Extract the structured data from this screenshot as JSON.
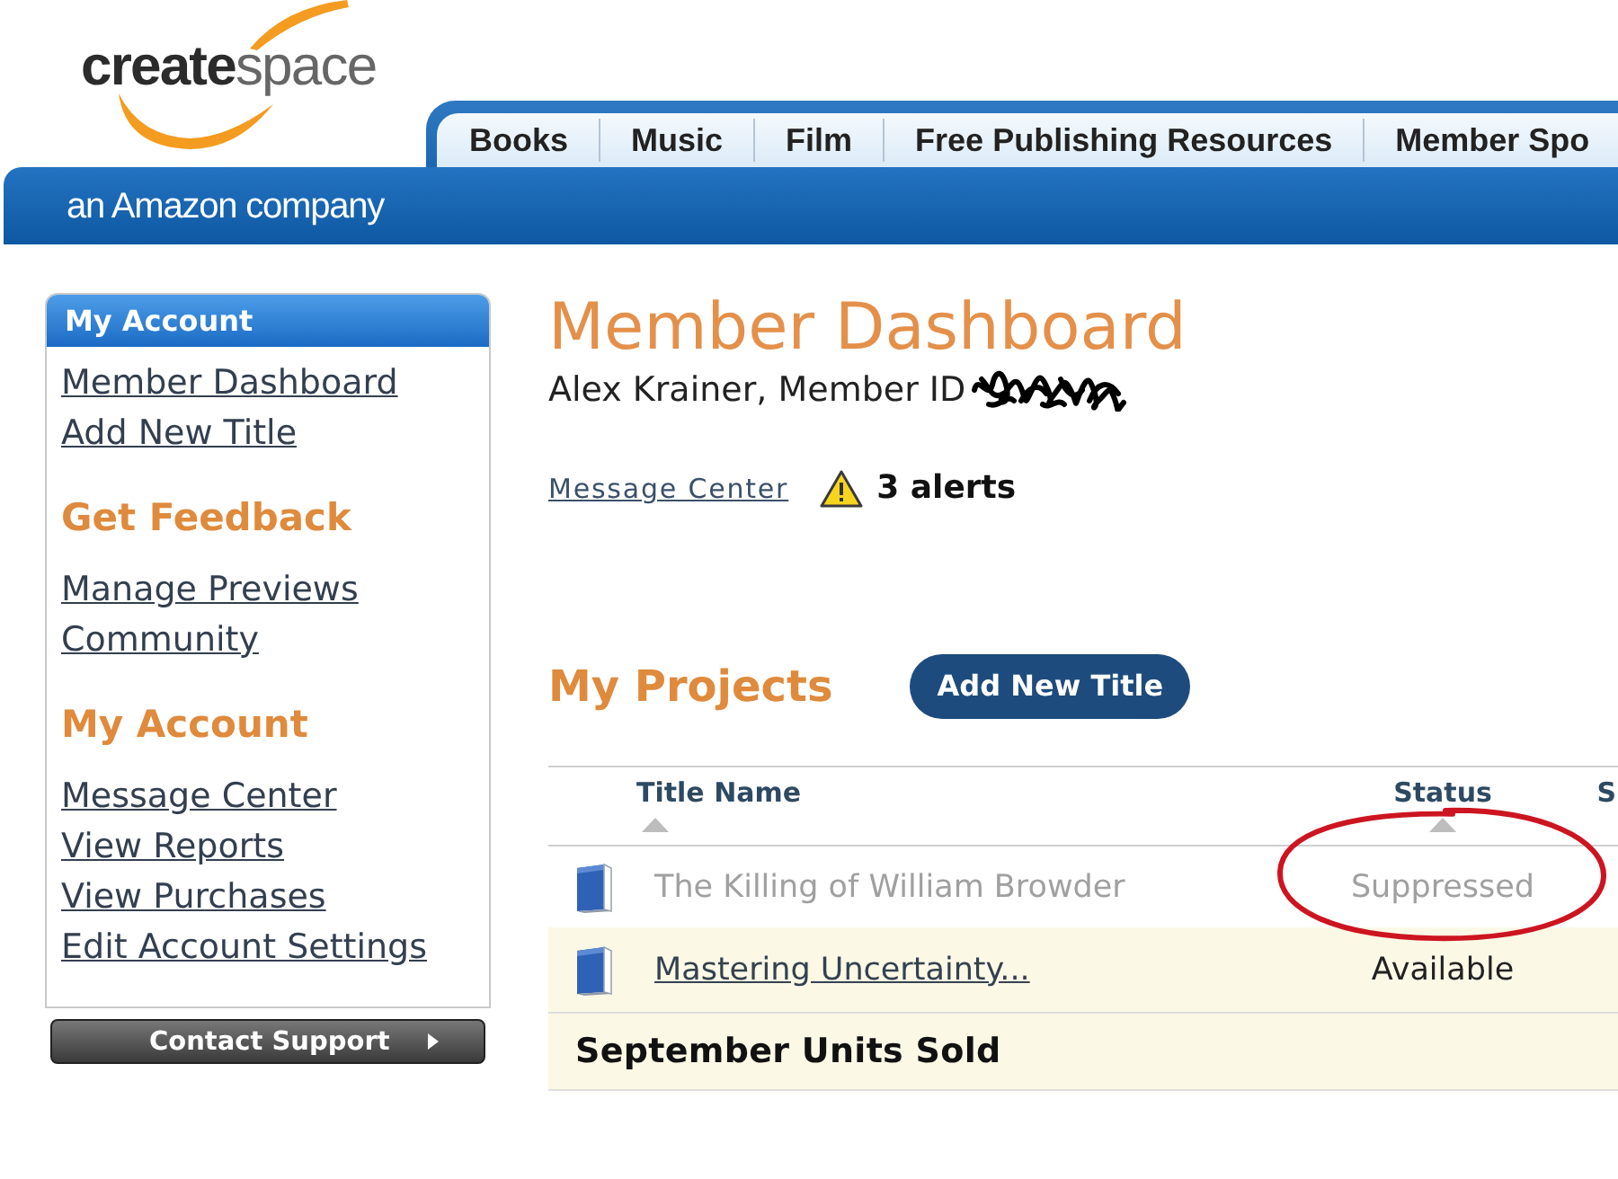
{
  "header": {
    "logo": "**create**space",
    "tagline": "an Amazon company",
    "tabs": [
      {
        "label": "Books",
        "selected": false
      },
      {
        "label": "Music",
        "selected": false
      },
      {
        "label": "Film",
        "selected": false
      },
      {
        "label": "Free Publishing Resources",
        "selected": false
      },
      {
        "label": "Member Spo",
        "selected": false
      }
    ]
  },
  "sidebar": {
    "title": "My Account",
    "sections": [
      {
        "links": [
          "Member Dashboard",
          "Add New Title"
        ]
      },
      {
        "heading": "Get Feedback",
        "links": [
          "Manage Previews",
          "Community"
        ]
      },
      {
        "heading": "My Account",
        "links": [
          "Message Center",
          "View Reports",
          "View Purchases",
          "Edit Account Settings"
        ]
      }
    ],
    "support_button": "Contact Support"
  },
  "main": {
    "title": "Member Dashboard",
    "member_line": "Alex Krainer, Member ID",
    "member_id_redacted": true,
    "message_link": "Message Center",
    "alerts": "3 alerts",
    "projects_heading": "My Projects",
    "add_button": "Add New Title",
    "table": {
      "columns": [
        {
          "label": "Title Name",
          "sort_arrow": true
        },
        {
          "label": "Status",
          "sort_arrow": true
        },
        {
          "label": "S",
          "sort_arrow": false
        }
      ],
      "rows": [
        {
          "title": "The Killing of William Browder",
          "status": "Suppressed",
          "disabled": true,
          "circled": true
        },
        {
          "title": "Mastering Uncertainty...",
          "status": "Available",
          "disabled": false,
          "circled": false
        }
      ],
      "summary": "September Units Sold"
    }
  }
}
